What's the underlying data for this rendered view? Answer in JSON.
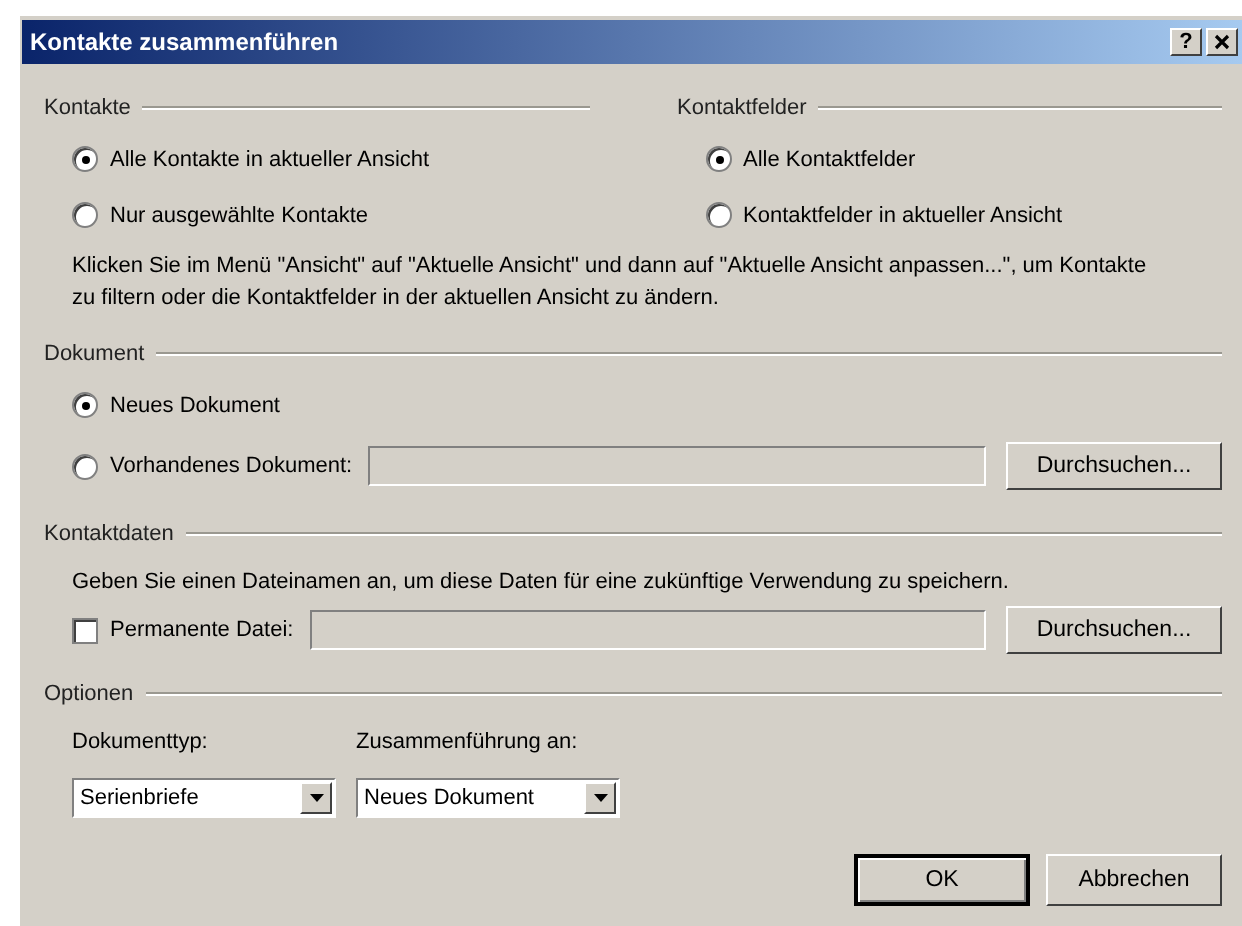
{
  "window": {
    "title": "Kontakte zusammenführen",
    "help": "?"
  },
  "contacts": {
    "heading": "Kontakte",
    "options": [
      {
        "label": "Alle Kontakte in aktueller Ansicht",
        "selected": true
      },
      {
        "label": "Nur ausgewählte Kontakte",
        "selected": false
      }
    ]
  },
  "fields": {
    "heading": "Kontaktfelder",
    "options": [
      {
        "label": "Alle Kontaktfelder",
        "selected": true
      },
      {
        "label": "Kontaktfelder in aktueller Ansicht",
        "selected": false
      }
    ]
  },
  "note": "Klicken Sie im Menü \"Ansicht\" auf \"Aktuelle Ansicht\" und dann auf \"Aktuelle Ansicht anpassen...\", um Kontakte zu filtern oder die Kontaktfelder in der aktuellen Ansicht zu ändern.",
  "document": {
    "heading": "Dokument",
    "options": [
      {
        "label": "Neues Dokument",
        "selected": true,
        "kind": "plain"
      },
      {
        "label": "Vorhandenes Dokument:",
        "selected": false,
        "kind": "file",
        "button": "Durchsuchen..."
      }
    ]
  },
  "contact_data": {
    "heading": "Kontaktdaten",
    "description": "Geben Sie einen Dateinamen an, um diese Daten für eine zukünftige Verwendung zu speichern.",
    "checkbox": {
      "label": "Permanente Datei:",
      "checked": false
    },
    "button": "Durchsuchen..."
  },
  "options": {
    "heading": "Optionen",
    "dropdowns": [
      {
        "label": "Dokumenttyp:",
        "value": "Serienbriefe"
      },
      {
        "label": "Zusammenführung an:",
        "value": "Neues Dokument"
      }
    ]
  },
  "buttons": [
    {
      "label": "OK",
      "default": true
    },
    {
      "label": "Abbrechen",
      "default": false
    }
  ]
}
